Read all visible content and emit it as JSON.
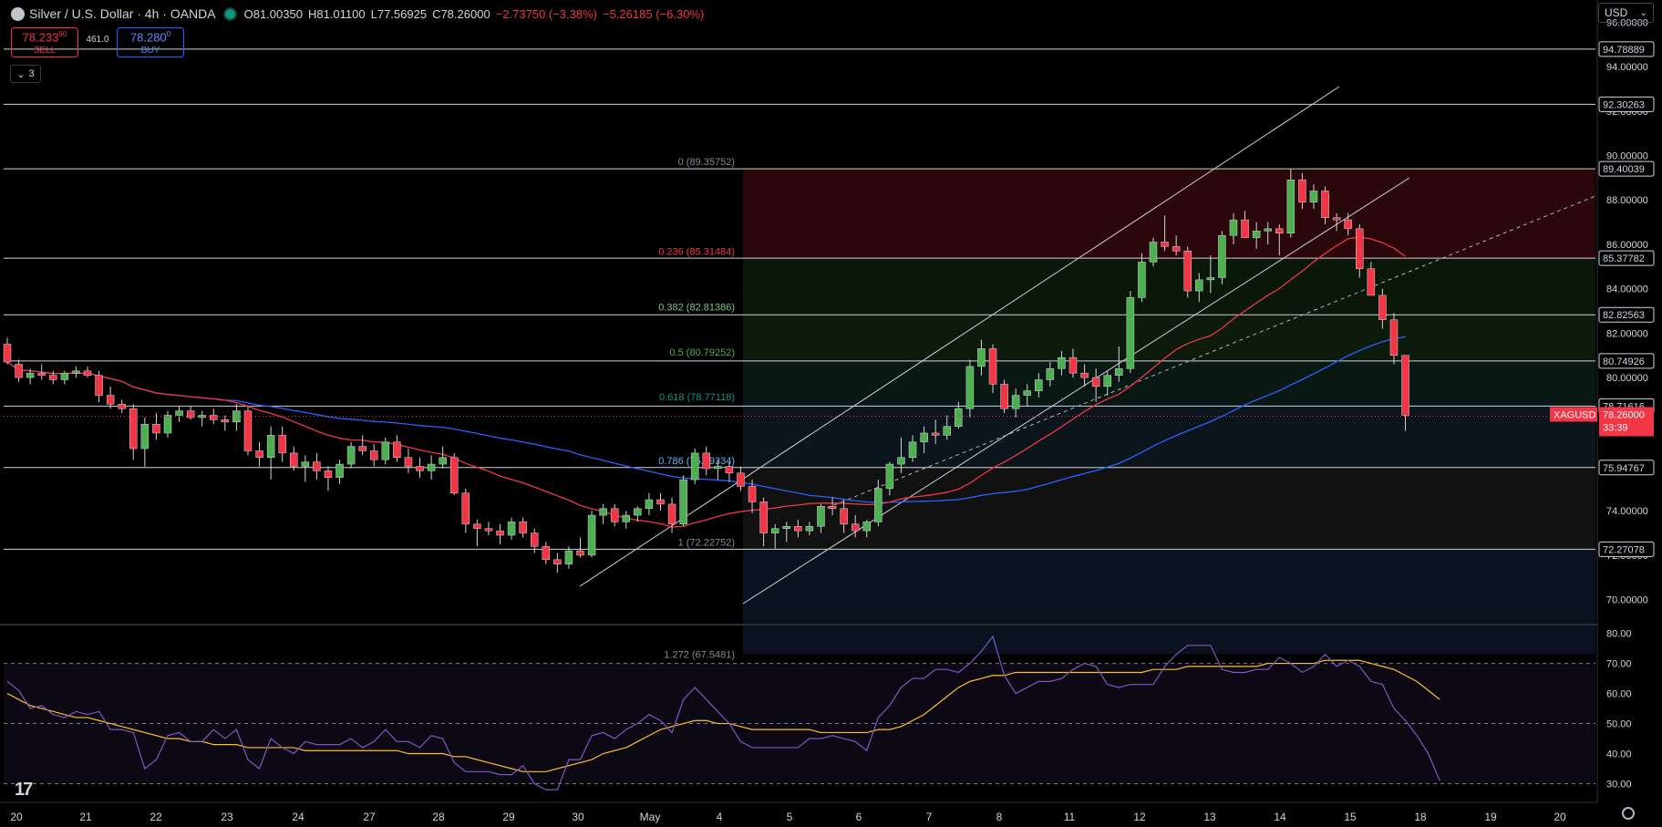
{
  "header": {
    "title": "Silver / U.S. Dollar · 4h · OANDA",
    "open": "O81.00350",
    "high": "H81.01100",
    "low": "L77.56925",
    "close": "C78.26000",
    "change": "−2.73750 (−3.38%)",
    "change2": "−5.26185 (−6.30%)"
  },
  "trade": {
    "sell_price": "78.233",
    "sell_sup": "9",
    "sell_sup2": "0",
    "sell_label": "SELL",
    "spread": "461.0",
    "buy_price": "78.280",
    "buy_sup": "0",
    "buy_label": "BUY"
  },
  "indicator_count": "3",
  "currency": "USD",
  "symbol_badge": {
    "symbol": "XAGUSD",
    "price": "78.26000",
    "countdown": "33:39"
  },
  "price_axis_ticks": [
    "96.00000",
    "94.00000",
    "92.00000",
    "90.00000",
    "88.00000",
    "86.00000",
    "84.00000",
    "82.00000",
    "80.00000",
    "78.00000",
    "76.00000",
    "74.00000",
    "72.00000",
    "70.00000"
  ],
  "horizontal_levels": [
    "94.78889",
    "92.30263",
    "89.40039",
    "85.37782",
    "82.82563",
    "80.74926",
    "78.71616",
    "75.94767",
    "72.27078"
  ],
  "fib_levels": [
    {
      "label": "0 (89.35752)",
      "color": "#868993"
    },
    {
      "label": "0.236 (85.31484)",
      "color": "#f23645"
    },
    {
      "label": "0.382 (82.81386)",
      "color": "#81c784"
    },
    {
      "label": "0.5 (80.79252)",
      "color": "#4caf50"
    },
    {
      "label": "0.618 (78.77118)",
      "color": "#089981"
    },
    {
      "label": "0.786 (75.89334)",
      "color": "#64b5f6"
    },
    {
      "label": "1 (72.22752)",
      "color": "#868993"
    }
  ],
  "fib_partial_label": "1.272 (67.5481)",
  "rsi_axis_ticks": [
    "80.00",
    "70.00",
    "60.00",
    "50.00",
    "40.00",
    "30.00"
  ],
  "time_axis": [
    "20",
    "21",
    "22",
    "23",
    "24",
    "27",
    "28",
    "29",
    "30",
    "May",
    "4",
    "5",
    "6",
    "7",
    "8",
    "11",
    "12",
    "13",
    "14",
    "15",
    "18",
    "19",
    "20"
  ],
  "colors": {
    "up": "#4caf50",
    "down": "#f23645",
    "ma_fast": "#f23645",
    "ma_slow": "#2962ff",
    "rsi": "#7e57c2",
    "rsi_ma": "#fbc02d"
  },
  "chart_data": {
    "type": "candlestick",
    "price_axis_range": [
      69,
      97
    ],
    "rsi_axis_range": [
      25,
      82
    ],
    "candles": [
      [
        81.5,
        81.8,
        80.6,
        80.7
      ],
      [
        80.6,
        80.8,
        79.8,
        80.0
      ],
      [
        80.0,
        80.4,
        79.7,
        80.2
      ],
      [
        80.2,
        80.6,
        79.9,
        80.1
      ],
      [
        80.1,
        80.3,
        79.7,
        79.9
      ],
      [
        79.9,
        80.3,
        79.7,
        80.2
      ],
      [
        80.2,
        80.5,
        80.0,
        80.3
      ],
      [
        80.3,
        80.5,
        80.0,
        80.1
      ],
      [
        80.1,
        80.3,
        78.9,
        79.2
      ],
      [
        79.2,
        79.6,
        78.6,
        78.8
      ],
      [
        78.8,
        79.0,
        78.4,
        78.6
      ],
      [
        78.6,
        78.8,
        76.3,
        76.8
      ],
      [
        76.8,
        78.2,
        76.0,
        77.9
      ],
      [
        77.9,
        78.4,
        77.2,
        77.5
      ],
      [
        77.5,
        78.5,
        77.3,
        78.3
      ],
      [
        78.3,
        78.7,
        78.0,
        78.5
      ],
      [
        78.5,
        78.7,
        78.1,
        78.2
      ],
      [
        78.2,
        78.5,
        77.8,
        78.3
      ],
      [
        78.3,
        78.6,
        77.9,
        78.1
      ],
      [
        78.1,
        78.3,
        77.6,
        78.0
      ],
      [
        78.0,
        78.8,
        77.6,
        78.5
      ],
      [
        78.5,
        78.7,
        76.5,
        76.7
      ],
      [
        76.7,
        77.1,
        76.0,
        76.4
      ],
      [
        76.4,
        77.8,
        75.4,
        77.4
      ],
      [
        77.4,
        77.8,
        76.2,
        76.6
      ],
      [
        76.6,
        76.9,
        75.8,
        76.0
      ],
      [
        76.0,
        76.5,
        75.3,
        76.2
      ],
      [
        76.2,
        76.6,
        75.4,
        75.8
      ],
      [
        75.8,
        76.0,
        74.9,
        75.5
      ],
      [
        75.5,
        76.3,
        75.2,
        76.1
      ],
      [
        76.1,
        77.1,
        75.9,
        76.9
      ],
      [
        76.9,
        77.4,
        76.5,
        76.7
      ],
      [
        76.7,
        77.0,
        76.0,
        76.3
      ],
      [
        76.3,
        77.3,
        76.1,
        77.1
      ],
      [
        77.1,
        77.4,
        76.2,
        76.4
      ],
      [
        76.4,
        76.8,
        75.7,
        76.0
      ],
      [
        76.0,
        76.4,
        75.5,
        75.8
      ],
      [
        75.8,
        76.5,
        75.4,
        76.1
      ],
      [
        76.1,
        76.9,
        75.9,
        76.4
      ],
      [
        76.4,
        76.6,
        74.7,
        74.8
      ],
      [
        74.8,
        75.0,
        73.0,
        73.4
      ],
      [
        73.4,
        73.6,
        72.4,
        73.2
      ],
      [
        73.2,
        73.5,
        72.9,
        73.1
      ],
      [
        73.1,
        73.4,
        72.5,
        72.9
      ],
      [
        72.9,
        73.7,
        72.7,
        73.5
      ],
      [
        73.5,
        73.7,
        72.8,
        73.0
      ],
      [
        73.0,
        73.2,
        72.1,
        72.4
      ],
      [
        72.4,
        72.6,
        71.6,
        71.8
      ],
      [
        71.8,
        72.1,
        71.2,
        71.6
      ],
      [
        71.6,
        72.4,
        71.4,
        72.2
      ],
      [
        72.2,
        72.8,
        71.9,
        72.0
      ],
      [
        72.0,
        74.0,
        71.9,
        73.8
      ],
      [
        73.8,
        74.3,
        73.4,
        74.1
      ],
      [
        74.1,
        74.3,
        73.3,
        73.5
      ],
      [
        73.5,
        74.0,
        73.2,
        73.8
      ],
      [
        73.8,
        74.2,
        73.5,
        74.1
      ],
      [
        74.1,
        74.8,
        73.8,
        74.5
      ],
      [
        74.5,
        74.8,
        74.0,
        74.3
      ],
      [
        74.3,
        74.6,
        73.0,
        73.4
      ],
      [
        73.4,
        75.6,
        73.3,
        75.4
      ],
      [
        75.4,
        76.8,
        75.2,
        76.6
      ],
      [
        76.6,
        76.9,
        75.6,
        75.9
      ],
      [
        75.9,
        76.3,
        75.4,
        76.0
      ],
      [
        76.0,
        76.2,
        75.3,
        75.7
      ],
      [
        75.7,
        76.0,
        74.9,
        75.1
      ],
      [
        75.1,
        75.4,
        73.9,
        74.4
      ],
      [
        74.4,
        74.6,
        72.4,
        73.0
      ],
      [
        73.0,
        73.4,
        72.3,
        73.2
      ],
      [
        73.2,
        73.5,
        72.6,
        73.3
      ],
      [
        73.3,
        73.6,
        72.8,
        73.1
      ],
      [
        73.1,
        73.5,
        72.9,
        73.3
      ],
      [
        73.3,
        74.3,
        73.0,
        74.2
      ],
      [
        74.2,
        74.6,
        73.8,
        74.1
      ],
      [
        74.1,
        74.5,
        73.0,
        73.4
      ],
      [
        73.4,
        73.8,
        72.8,
        73.1
      ],
      [
        73.1,
        73.6,
        72.8,
        73.5
      ],
      [
        73.5,
        75.4,
        73.3,
        75.0
      ],
      [
        75.0,
        76.2,
        74.7,
        76.1
      ],
      [
        76.1,
        77.3,
        75.7,
        76.4
      ],
      [
        76.4,
        77.4,
        76.2,
        77.1
      ],
      [
        77.1,
        77.8,
        76.6,
        77.5
      ],
      [
        77.5,
        78.1,
        77.0,
        77.4
      ],
      [
        77.4,
        78.3,
        77.2,
        77.8
      ],
      [
        77.8,
        78.9,
        77.7,
        78.6
      ],
      [
        78.6,
        80.8,
        78.2,
        80.5
      ],
      [
        80.5,
        81.7,
        80.1,
        81.3
      ],
      [
        81.3,
        81.5,
        79.3,
        79.7
      ],
      [
        79.7,
        79.9,
        78.4,
        78.6
      ],
      [
        78.6,
        79.5,
        78.2,
        79.2
      ],
      [
        79.2,
        79.7,
        78.7,
        79.4
      ],
      [
        79.4,
        80.2,
        79.1,
        79.9
      ],
      [
        79.9,
        80.7,
        79.6,
        80.4
      ],
      [
        80.4,
        81.2,
        80.1,
        80.9
      ],
      [
        80.9,
        81.3,
        80.0,
        80.2
      ],
      [
        80.2,
        80.6,
        79.6,
        80.0
      ],
      [
        80.0,
        80.4,
        78.9,
        79.6
      ],
      [
        79.6,
        80.3,
        79.2,
        80.1
      ],
      [
        80.1,
        81.4,
        79.8,
        80.4
      ],
      [
        80.4,
        83.9,
        80.2,
        83.6
      ],
      [
        83.6,
        85.6,
        83.4,
        85.2
      ],
      [
        85.2,
        86.3,
        85.0,
        86.1
      ],
      [
        86.1,
        87.3,
        85.7,
        85.9
      ],
      [
        85.9,
        86.4,
        85.5,
        85.7
      ],
      [
        85.7,
        85.9,
        83.6,
        83.9
      ],
      [
        83.9,
        84.7,
        83.4,
        84.4
      ],
      [
        84.4,
        85.5,
        83.8,
        84.5
      ],
      [
        84.5,
        86.6,
        84.2,
        86.4
      ],
      [
        86.4,
        87.4,
        86.0,
        87.1
      ],
      [
        87.1,
        87.5,
        86.7,
        86.3
      ],
      [
        86.3,
        87.0,
        85.8,
        86.6
      ],
      [
        86.6,
        87.0,
        86.0,
        86.7
      ],
      [
        86.7,
        86.9,
        85.5,
        86.5
      ],
      [
        86.5,
        89.4,
        86.3,
        88.9
      ],
      [
        88.9,
        89.2,
        87.6,
        87.9
      ],
      [
        87.9,
        88.7,
        87.6,
        88.4
      ],
      [
        88.4,
        88.6,
        86.9,
        87.2
      ],
      [
        87.2,
        87.4,
        86.6,
        87.1
      ],
      [
        87.1,
        87.4,
        86.4,
        86.7
      ],
      [
        86.7,
        86.9,
        84.5,
        84.9
      ],
      [
        84.9,
        85.2,
        83.8,
        83.7
      ],
      [
        83.7,
        84.0,
        82.2,
        82.6
      ],
      [
        82.6,
        82.9,
        80.6,
        81.0
      ],
      [
        81.0,
        81.0,
        77.6,
        78.3
      ]
    ],
    "rsi_path": [
      64,
      61,
      55,
      56,
      53,
      52,
      54,
      53,
      54,
      48,
      48,
      47,
      35,
      38,
      46,
      47,
      44,
      44,
      48,
      45,
      48,
      38,
      35,
      45,
      42,
      40,
      44,
      43,
      43,
      43,
      45,
      42,
      44,
      48,
      44,
      44,
      42,
      46,
      45,
      37,
      34,
      34,
      34,
      33,
      33,
      36,
      30,
      28,
      28,
      38,
      38,
      46,
      47,
      45,
      48,
      50,
      53,
      51,
      47,
      58,
      62,
      58,
      54,
      50,
      44,
      42,
      42,
      42,
      42,
      42,
      45,
      45,
      46,
      45,
      44,
      41,
      52,
      56,
      62,
      65,
      65,
      68,
      68,
      67,
      70,
      74,
      79,
      66,
      60,
      62,
      64,
      64,
      65,
      68,
      70,
      69,
      63,
      62,
      63,
      63,
      63,
      69,
      73,
      76,
      76,
      76,
      68,
      67,
      67,
      68,
      68,
      72,
      70,
      67,
      69,
      73,
      69,
      71,
      69,
      64,
      63,
      55,
      51,
      46,
      40,
      31
    ],
    "rsi_ma_path": [
      60,
      58,
      56,
      55,
      54,
      53,
      52,
      52,
      51,
      50,
      49,
      48,
      47,
      46,
      45,
      45,
      44,
      44,
      43,
      43,
      43,
      42,
      42,
      42,
      42,
      42,
      41,
      41,
      41,
      41,
      41,
      41,
      41,
      41,
      41,
      40,
      40,
      40,
      40,
      39,
      39,
      38,
      37,
      36,
      35,
      34,
      34,
      34,
      35,
      36,
      37,
      38,
      40,
      41,
      42,
      44,
      46,
      48,
      49,
      50,
      51,
      51,
      50,
      50,
      49,
      48,
      48,
      48,
      48,
      48,
      48,
      47,
      47,
      47,
      47,
      47,
      48,
      48,
      49,
      51,
      53,
      56,
      59,
      62,
      64,
      65,
      66,
      66,
      67,
      67,
      67,
      67,
      67,
      67,
      67,
      67,
      67,
      67,
      67,
      67,
      68,
      68,
      68,
      69,
      69,
      69,
      69,
      69,
      69,
      69,
      70,
      70,
      70,
      70,
      70,
      71,
      71,
      71,
      71,
      70,
      69,
      68,
      66,
      64,
      61,
      58
    ]
  }
}
